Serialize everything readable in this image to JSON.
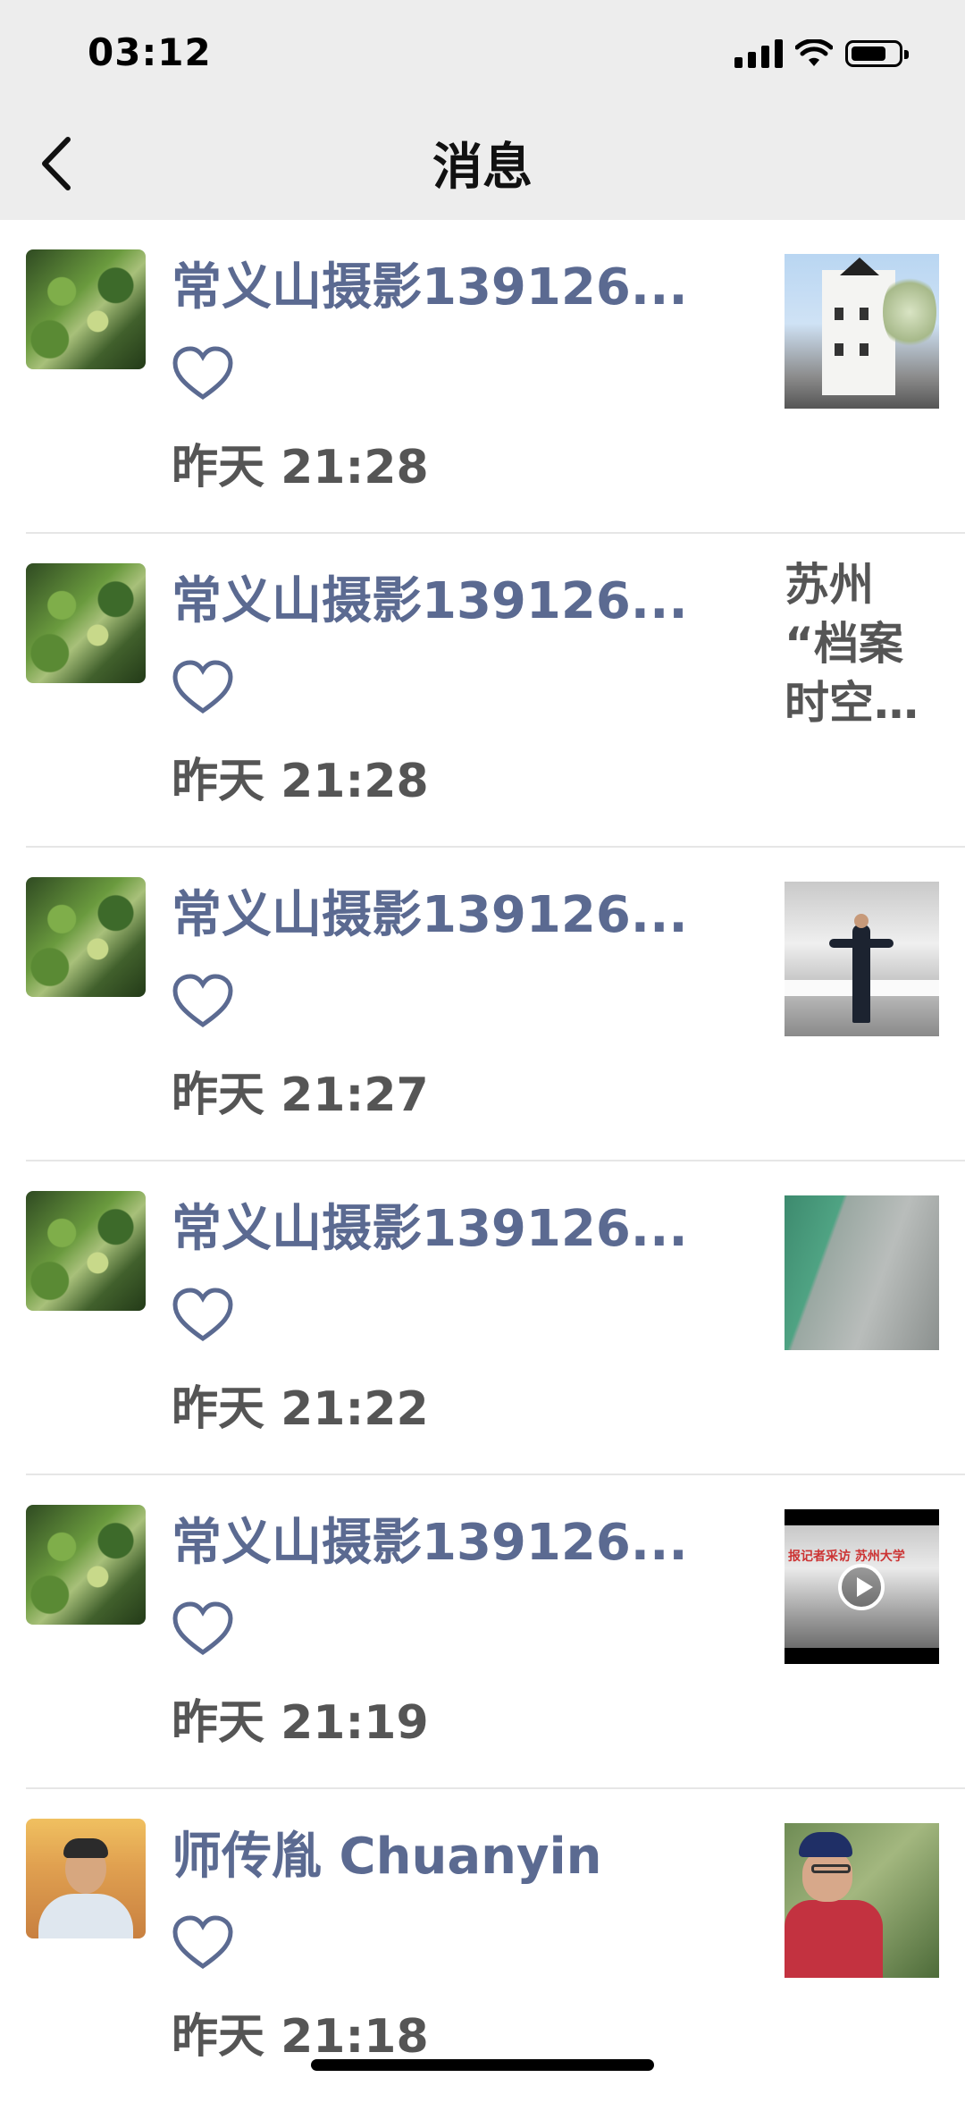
{
  "status_bar": {
    "time": "03:12"
  },
  "nav": {
    "title": "消息"
  },
  "messages": [
    {
      "sender": "常义山摄影139126...",
      "time": "昨天 21:28",
      "avatar": "landscape-stairs-avatar",
      "thumbnail": "building-photo"
    },
    {
      "sender": "常义山摄影139126...",
      "time": "昨天 21:28",
      "avatar": "landscape-stairs-avatar",
      "thumbnail_text": "苏州\n“档案\n时空…"
    },
    {
      "sender": "常义山摄影139126...",
      "time": "昨天 21:27",
      "avatar": "landscape-stairs-avatar",
      "thumbnail": "hall-speaker-photo"
    },
    {
      "sender": "常义山摄影139126...",
      "time": "昨天 21:22",
      "avatar": "landscape-stairs-avatar",
      "thumbnail": "corridor-floor-photo"
    },
    {
      "sender": "常义山摄影139126...",
      "time": "昨天 21:19",
      "avatar": "landscape-stairs-avatar",
      "thumbnail": "video-thumbnail",
      "thumbnail_caption": "报记者采访  苏州大学"
    },
    {
      "sender": "师传胤 Chuanyin",
      "time": "昨天 21:18",
      "avatar": "person-avatar",
      "thumbnail": "portrait-photo"
    }
  ],
  "colors": {
    "name": "#5b6a91",
    "bar": "#ededed",
    "heart": "#5b6a91"
  }
}
